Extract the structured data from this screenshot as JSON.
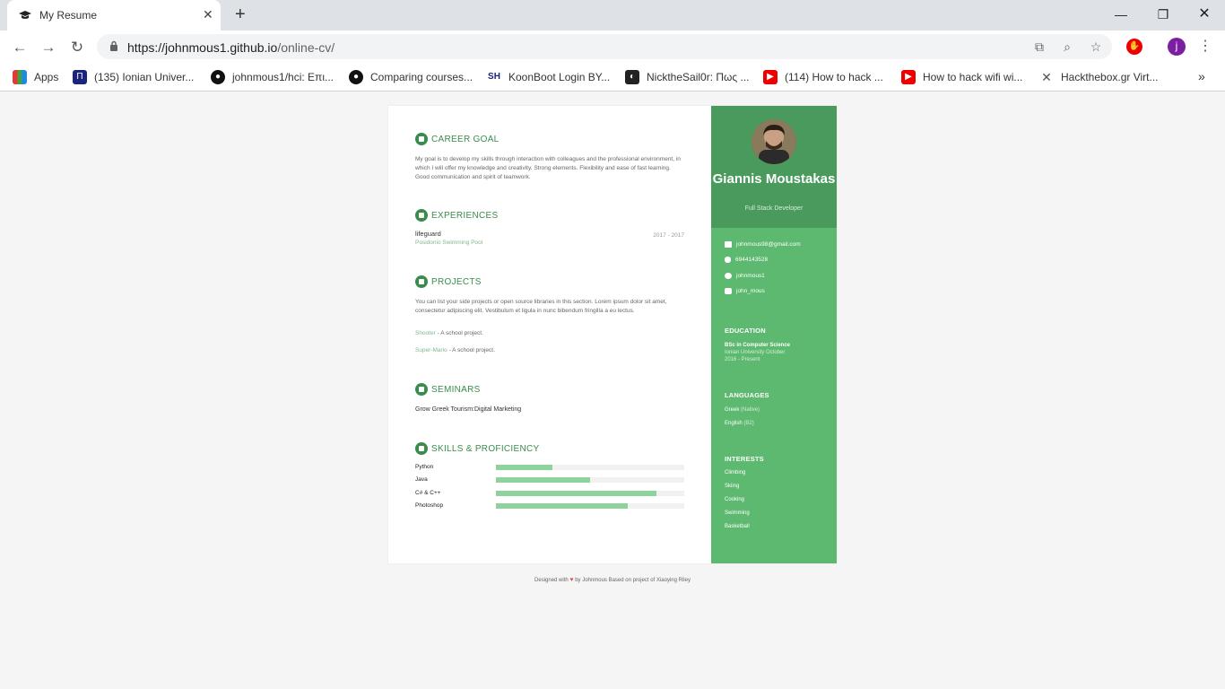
{
  "browser": {
    "tab_title": "My Resume",
    "url_host": "https://johnmous1.github.io",
    "url_path": "/online-cv/",
    "avatar_letter": "j",
    "bookmarks": [
      {
        "label": "Apps",
        "icon": "apps-grid-icon"
      },
      {
        "label": "(135) Ionian Univer...",
        "icon": "ionian-university-icon"
      },
      {
        "label": "johnmous1/hci: Επι...",
        "icon": "github-icon"
      },
      {
        "label": "Comparing courses...",
        "icon": "github-icon"
      },
      {
        "label": "KoonBoot Login BY...",
        "icon": "koonboot-icon"
      },
      {
        "label": "NicktheSail0r: Πως ...",
        "icon": "site-icon"
      },
      {
        "label": "(114) How to hack ...",
        "icon": "youtube-icon"
      },
      {
        "label": "How to hack wifi wi...",
        "icon": "youtube-icon"
      },
      {
        "label": "Hackthebox.gr Virt...",
        "icon": "hackthebox-icon"
      }
    ]
  },
  "resume": {
    "name": "Giannis Moustakas",
    "tagline": "Full Stack Developer",
    "career": {
      "title": "CAREER GOAL",
      "text": "My goal is to develop my skills through interaction with colleagues and the professional environment, in which I will offer my knowledge and creativity. Strong elements. Flexibility and ease of fast learning. Good communication and spirit of teamwork."
    },
    "experiences": {
      "title": "EXPERIENCES",
      "role": "lifeguard",
      "company": "Posidonio Swimming Pool",
      "dates": "2017 - 2017"
    },
    "projects": {
      "title": "PROJECTS",
      "intro": "You can list your side projects or open source libraries in this section. Lorem ipsum dolor sit amet, consectetur adipiscing elit. Vestibulum et ligula in nunc bibendum fringilla a eu lectus.",
      "items": [
        {
          "name": "Shooter",
          "desc": " - A school project."
        },
        {
          "name": "Super-Mario",
          "desc": " - A school project."
        }
      ]
    },
    "seminars": {
      "title": "SEMINARS",
      "item": "Grow Greek Tourism:Digital Marketing"
    },
    "skills": {
      "title": "SKILLS & PROFICIENCY",
      "items": [
        {
          "name": "Python",
          "level": 0.3
        },
        {
          "name": "Java",
          "level": 0.5
        },
        {
          "name": "C# & C++",
          "level": 0.85
        },
        {
          "name": "Photoshop",
          "level": 0.7
        }
      ]
    },
    "contact": {
      "email": "johnmous98@gmail.com",
      "phone": "6944143528",
      "github": "johnmous1",
      "instagram": "john_mous"
    },
    "education": {
      "title": "EDUCATION",
      "degree": "BSc in Computer Science",
      "school": "Ionian University October",
      "dates": "2016 - Present"
    },
    "languages": {
      "title": "LANGUAGES",
      "items": [
        {
          "name": "Greek",
          "level": "(Native)"
        },
        {
          "name": "English",
          "level": "(B2)"
        }
      ]
    },
    "interests": {
      "title": "INTERESTS",
      "items": [
        "Climbing",
        "Skiing",
        "Cooking",
        "Swimming",
        "Basketball"
      ]
    },
    "footer": {
      "pre": "Designed with",
      "post": "by Johnmous Based on project of Xiaoying Riley"
    }
  }
}
